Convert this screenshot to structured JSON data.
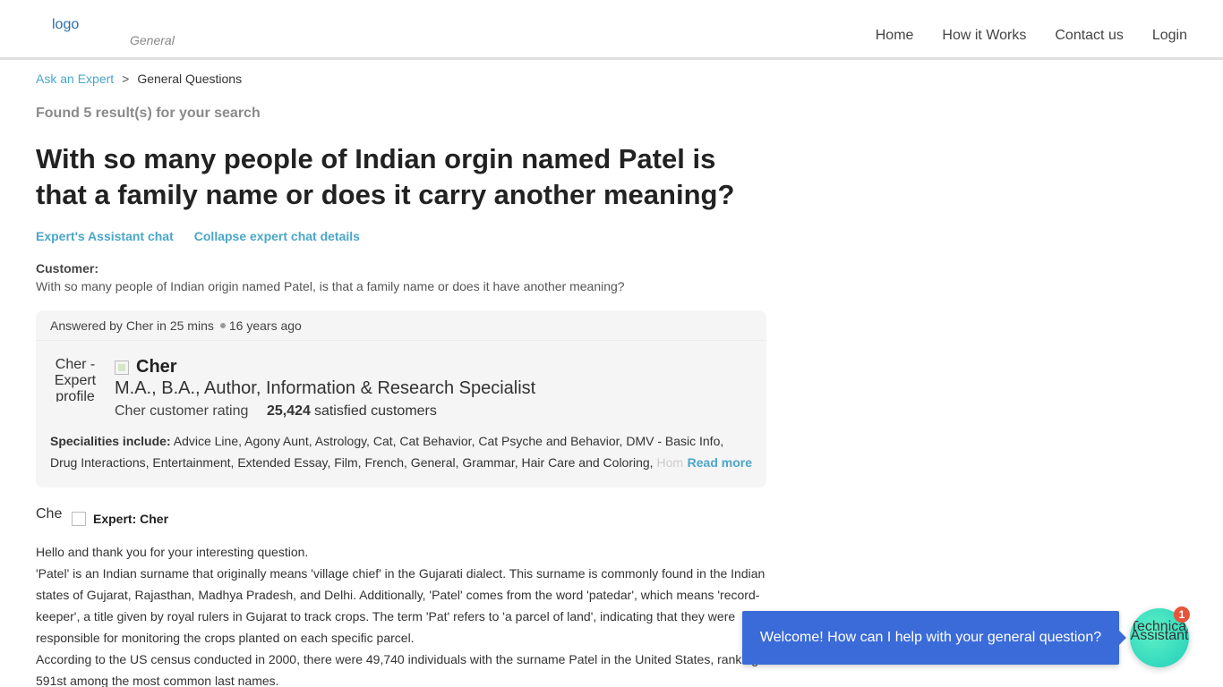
{
  "header": {
    "logo_alt": "logo",
    "logo_subtitle": "General",
    "nav": [
      "Home",
      "How it Works",
      "Contact us",
      "Login"
    ]
  },
  "breadcrumb": {
    "root": "Ask an Expert",
    "separator": ">",
    "current": "General Questions"
  },
  "search": {
    "found_text": "Found 5 result(s) for your search"
  },
  "question": {
    "title": "With so many people of Indian orgin named Patel is that a family name or does it carry another meaning?",
    "chat_link": "Expert's Assistant chat",
    "collapse_link": "Collapse expert chat details",
    "customer_label": "Customer:",
    "customer_text": "With so many people of Indian origin named Patel, is that a family name or does it have another meaning?"
  },
  "answer_card": {
    "answered_by": "Answered by Cher in 25 mins",
    "time_ago": "16 years ago",
    "photo_alt": "Cher - Expert profile",
    "expert_name": "Cher",
    "credentials": "M.A., B.A., Author, Information & Research Specialist",
    "rating_alt": "Cher customer rating",
    "satisfied_count": "25,424",
    "satisfied_label": "satisfied customers",
    "specialities_label": "Specialities include:",
    "specialities_text": "Advice Line, Agony Aunt, Astrology, Cat, Cat Behavior, Cat Psyche and Behavior, DMV - Basic Info, Drug Interactions, Entertainment, Extended Essay, Film, French, General, Grammar, Hair Care and Coloring,",
    "specialities_fade": "Hom",
    "read_more": "Read more"
  },
  "expert_reply": {
    "avatar_alt": "Cher",
    "expert_label": "Expert: Cher",
    "paragraphs": [
      "Hello and thank you for your interesting question.",
      "'Patel' is an Indian surname that originally means 'village chief' in the Gujarati dialect. This surname is commonly found in the Indian states of Gujarat, Rajasthan, Madhya Pradesh, and Delhi. Additionally, 'Patel' comes from the word 'patedar', which means 'record-keeper', a title given by royal rulers in Gujarat to track crops. The term 'Pat' refers to 'a parcel of land', indicating that they were responsible for monitoring the crops planted on each specific parcel.",
      "According to the US census conducted in 2000, there were 49,740 individuals with the surname Patel in the United States, ranking it 591st among the most common last names."
    ]
  },
  "chat_widget": {
    "welcome": "Welcome! How can I help with your general question?",
    "avatar_alt": "Technical Assistant",
    "badge_count": "1"
  },
  "colors": {
    "link": "#4aa6c9",
    "chat_bubble": "#3b6bd9",
    "badge": "#e4553a",
    "assistant_avatar": "#1fcfb8"
  }
}
